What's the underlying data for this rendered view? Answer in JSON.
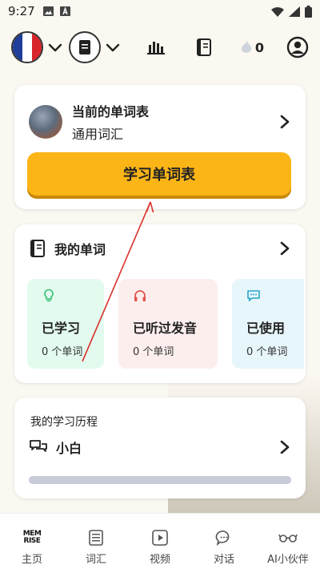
{
  "status_bar": {
    "time": "9:27"
  },
  "topbar": {
    "streak_count": "0",
    "flag_colors": [
      "#1f3d99",
      "#ffffff",
      "#d8232a"
    ]
  },
  "current_list": {
    "heading": "当前的单词表",
    "name": "通用词汇",
    "study_button": "学习单词表"
  },
  "my_words": {
    "title": "我的单词",
    "tiles": [
      {
        "label": "已学习",
        "count": "0 个单词",
        "icon": "lightbulb-icon",
        "color": "#2fbf71"
      },
      {
        "label": "已听过发音",
        "count": "0 个单词",
        "icon": "headphones-icon",
        "color": "#e2554f"
      },
      {
        "label": "已使用",
        "count": "0 个单词",
        "icon": "chat-bubble-icon",
        "color": "#27a7c9"
      }
    ]
  },
  "journey": {
    "title": "我的学习历程",
    "level": "小白",
    "progress": 0
  },
  "bottom_nav": {
    "logo_top": "MEM",
    "logo_bottom": "RISE",
    "items": [
      "主页",
      "词汇",
      "视频",
      "对话",
      "AI小伙伴"
    ]
  },
  "colors": {
    "accent": "#fbb516",
    "annotation": "#d9322b"
  }
}
